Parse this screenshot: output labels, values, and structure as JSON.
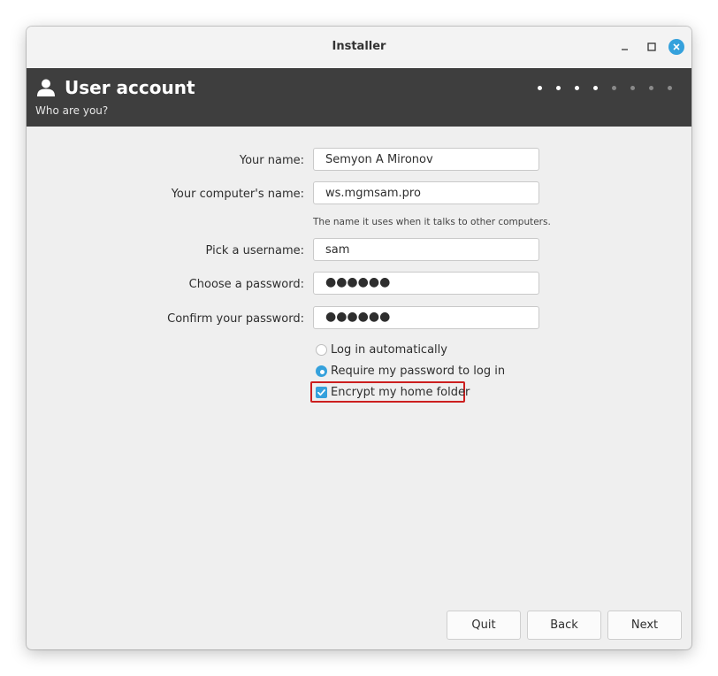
{
  "window": {
    "title": "Installer"
  },
  "header": {
    "title": "User account",
    "subtitle": "Who are you?",
    "progress": {
      "total_steps": 8,
      "current_step": 4
    }
  },
  "form": {
    "name_label": "Your name:",
    "name_value": "Semyon A Mironov",
    "computer_label": "Your computer's name:",
    "computer_value": "ws.mgmsam.pro",
    "computer_hint": "The name it uses when it talks to other computers.",
    "username_label": "Pick a username:",
    "username_value": "sam",
    "password_label": "Choose a password:",
    "password_value": "●●●●●●",
    "confirm_label": "Confirm your password:",
    "confirm_value": "●●●●●●"
  },
  "options": {
    "auto_login": "Log in automatically",
    "require_password": "Require my password to log in",
    "selected": "require_password",
    "encrypt_home": "Encrypt my home folder",
    "encrypt_checked": true
  },
  "buttons": {
    "quit": "Quit",
    "back": "Back",
    "next": "Next"
  },
  "colors": {
    "accent": "#35a1dc",
    "header_bg": "#3e3e3e",
    "highlight": "#cc1f1f"
  }
}
